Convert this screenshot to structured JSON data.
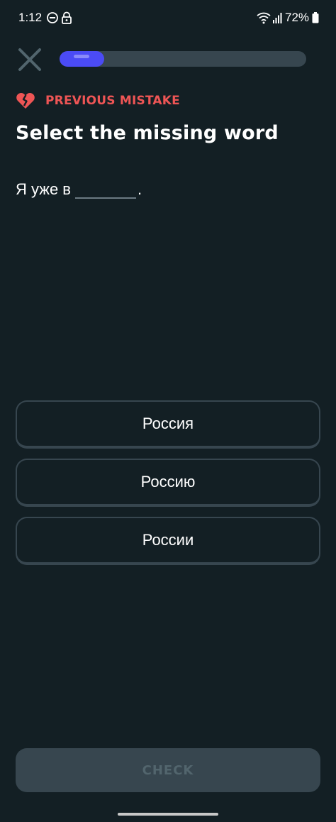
{
  "status_bar": {
    "time": "1:12",
    "battery": "72%",
    "icons": [
      "do-not-disturb-icon",
      "lock-icon",
      "wifi-icon",
      "signal-icon",
      "battery-icon"
    ]
  },
  "header": {
    "close_icon": "close-icon",
    "progress_fraction": 0.18
  },
  "mistake": {
    "icon": "broken-heart-icon",
    "label": "PREVIOUS MISTAKE"
  },
  "title": "Select the missing word",
  "sentence": {
    "before": "Я уже в",
    "after": "."
  },
  "options": [
    {
      "label": "Россия"
    },
    {
      "label": "Россию"
    },
    {
      "label": "России"
    }
  ],
  "check_button": {
    "label": "CHECK"
  },
  "colors": {
    "background": "#131f24",
    "accent": "#4b4bf5",
    "mistake": "#ee5555",
    "border": "#37464f",
    "disabled_text": "#52656d"
  }
}
